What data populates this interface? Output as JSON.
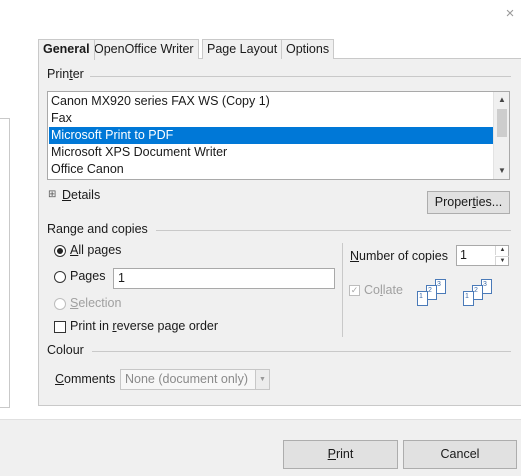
{
  "window": {
    "close_glyph": "×"
  },
  "tabs": [
    {
      "label": "General",
      "active": true
    },
    {
      "label": "OpenOffice Writer",
      "active": false
    },
    {
      "label": "Page Layout",
      "active": false
    },
    {
      "label": "Options",
      "active": false
    }
  ],
  "printer": {
    "section_label_pre": "Prin",
    "section_label_ul": "t",
    "section_label_post": "er",
    "items": [
      "Canon MX920 series FAX WS (Copy 1)",
      "Fax",
      "Microsoft Print to PDF",
      "Microsoft XPS Document Writer",
      "Office Canon"
    ],
    "selected_index": 2,
    "details_expander": "⊞",
    "details_ul": "D",
    "details_rest": "etails",
    "properties_pre": "Proper",
    "properties_ul": "t",
    "properties_post": "ies..."
  },
  "range": {
    "section_label": "Range and copies",
    "all_pages_ul": "A",
    "all_pages_rest": "ll pages",
    "pages_pre": "Pa",
    "pages_ul": "g",
    "pages_post": "es",
    "pages_value": "1",
    "selection_ul": "S",
    "selection_rest": "election",
    "reverse_pre": "Print in ",
    "reverse_ul": "r",
    "reverse_post": "everse page order",
    "selected_option": "all_pages"
  },
  "copies": {
    "label_ul": "N",
    "label_rest": "umber of copies",
    "value": "1",
    "collate_pre": "Co",
    "collate_ul": "l",
    "collate_post": "late",
    "collate_checked": true,
    "collate_enabled": false,
    "page_numbers": [
      "1",
      "2",
      "3"
    ]
  },
  "colour": {
    "section_label": "Colour",
    "comments_ul": "C",
    "comments_rest": "omments",
    "comments_value": "None (document only)"
  },
  "footer": {
    "print_ul": "P",
    "print_rest": "rint",
    "cancel_label": "Cancel"
  },
  "colors": {
    "selection": "#0078d7",
    "panel_bg": "#f0f0f0",
    "border": "#c9c9c9"
  }
}
